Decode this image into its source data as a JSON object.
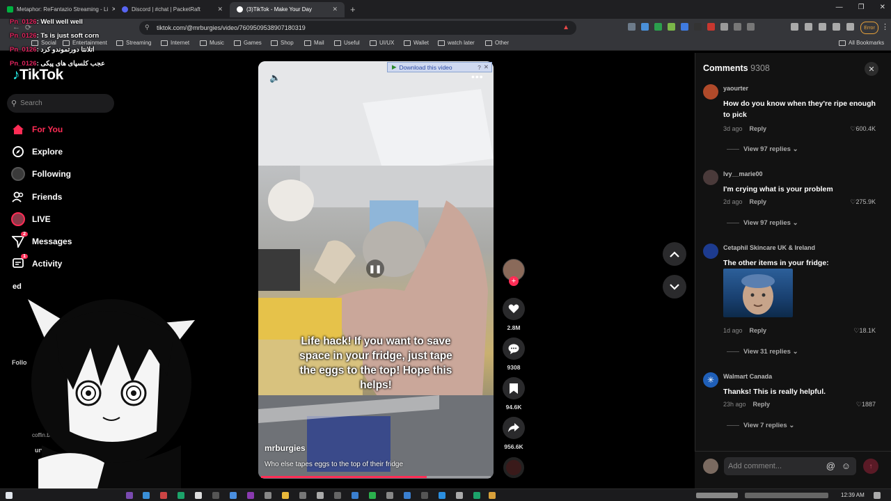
{
  "browser": {
    "tabs": [
      {
        "label": "Metaphor: ReFantazio Streaming - Li",
        "color": "#00b140",
        "active": false
      },
      {
        "label": "Discord | #chat | PacketRaft",
        "color": "#5865f2",
        "active": false
      },
      {
        "label": "(3)TikTok - Make Your Day",
        "color": "#222222",
        "active": true
      }
    ],
    "new_tab": "+",
    "url": "tiktok.com/@mrburgies/video/7609509538907180319",
    "error_label": "Error",
    "bookmarks": [
      "Social",
      "Entertainment",
      "Streaming",
      "Internet",
      "Music",
      "Games",
      "Shop",
      "Mail",
      "Useful",
      "UI/UX",
      "Wallet",
      "watch later",
      "Other"
    ],
    "all_bookmarks": "All Bookmarks"
  },
  "chat_overlay": [
    {
      "name": "Pn_0126",
      "msg": ": Well well well"
    },
    {
      "name": "Pn_0126",
      "msg": ": Ts is just soft corn"
    },
    {
      "name": "Pn_0126",
      "msg": ": اتلانتا دورتموندو کرد"
    },
    {
      "name": "Pn_0126",
      "msg": ": عجب کلسپای های پیکی"
    }
  ],
  "sidebar": {
    "logo": "TikTok",
    "search_placeholder": "Search",
    "nav": [
      {
        "label": "For You",
        "active": true
      },
      {
        "label": "Explore"
      },
      {
        "label": "Following"
      },
      {
        "label": "Friends"
      },
      {
        "label": "LIVE"
      },
      {
        "label": "Messages",
        "badge": "2"
      },
      {
        "label": "Activity",
        "badge": "1"
      }
    ],
    "partial_labels": [
      "ed",
      "Follo",
      "coffin.bag",
      "urva"
    ]
  },
  "video": {
    "download_label": "Download this video",
    "caption": "Life hack! If you want to save space in your fridge, just tape the eggs to the top! Hope this helps!",
    "author": "mrburgies",
    "description": "Who else tapes eggs to the top of their fridge",
    "progress": 0.72
  },
  "actions": {
    "likes": "2.8M",
    "comments": "9308",
    "saves": "94.6K",
    "shares": "956.6K"
  },
  "comments": {
    "title": "Comments",
    "count": "9308",
    "items": [
      {
        "user": "yaourter",
        "text": "How do you know when they're ripe enough to pick",
        "age": "3d ago",
        "reply": "Reply",
        "likes": "600.4K",
        "replies": "View 97 replies",
        "avatar_color": "#b04a2a"
      },
      {
        "user": "lvy__marie00",
        "text": "I'm crying what is your problem",
        "age": "2d ago",
        "reply": "Reply",
        "likes": "275.9K",
        "replies": "View 97 replies",
        "avatar_color": "#4a3a3a"
      },
      {
        "user": "Cetaphil Skincare UK & Ireland",
        "text": "The other items in your fridge:",
        "age": "1d ago",
        "reply": "Reply",
        "likes": "18.1K",
        "replies": "View 31 replies",
        "avatar_color": "#1d3b8f"
      },
      {
        "user": "Walmart Canada",
        "text": "Thanks! This is really helpful.",
        "age": "23h ago",
        "reply": "Reply",
        "likes": "1887",
        "replies": "View 7 replies",
        "avatar_color": "#1f5fb8"
      }
    ],
    "input_placeholder": "Add comment..."
  },
  "taskbar": {
    "clock": "12:39 AM"
  }
}
